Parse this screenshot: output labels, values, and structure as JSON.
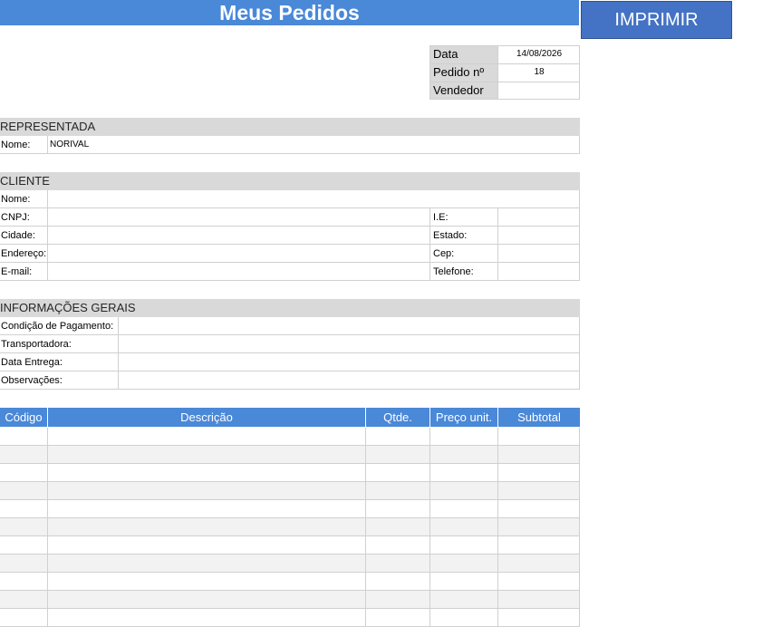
{
  "title": "Meus Pedidos",
  "print_button": "IMPRIMIR",
  "order_info": {
    "date_label": "Data",
    "date_value": "14/08/2026",
    "order_label": "Pedido nº",
    "order_value": "18",
    "seller_label": "Vendedor",
    "seller_value": ""
  },
  "representada": {
    "header": "REPRESENTADA",
    "name_label": "Nome:",
    "name_value": "NORIVAL"
  },
  "cliente": {
    "header": "CLIENTE",
    "name_label": "Nome:",
    "cnpj_label": "CNPJ:",
    "ie_label": "I.E:",
    "city_label": "Cidade:",
    "state_label": "Estado:",
    "address_label": "Endereço:",
    "cep_label": "Cep:",
    "email_label": "E-mail:",
    "phone_label": "Telefone:"
  },
  "info_gerais": {
    "header": "INFORMAÇÕES GERAIS",
    "payment_label": "Condição de Pagamento:",
    "carrier_label": "Transportadora:",
    "delivery_label": "Data Entrega:",
    "notes_label": "Observações:"
  },
  "items_table": {
    "columns": [
      "Código",
      "Descrição",
      "Qtde.",
      "Preço unit.",
      "Subtotal"
    ],
    "rows": [
      [
        "",
        "",
        "",
        "",
        ""
      ],
      [
        "",
        "",
        "",
        "",
        ""
      ],
      [
        "",
        "",
        "",
        "",
        ""
      ],
      [
        "",
        "",
        "",
        "",
        ""
      ],
      [
        "",
        "",
        "",
        "",
        ""
      ],
      [
        "",
        "",
        "",
        "",
        ""
      ],
      [
        "",
        "",
        "",
        "",
        ""
      ],
      [
        "",
        "",
        "",
        "",
        ""
      ],
      [
        "",
        "",
        "",
        "",
        ""
      ],
      [
        "",
        "",
        "",
        "",
        ""
      ],
      [
        "",
        "",
        "",
        "",
        ""
      ]
    ]
  }
}
